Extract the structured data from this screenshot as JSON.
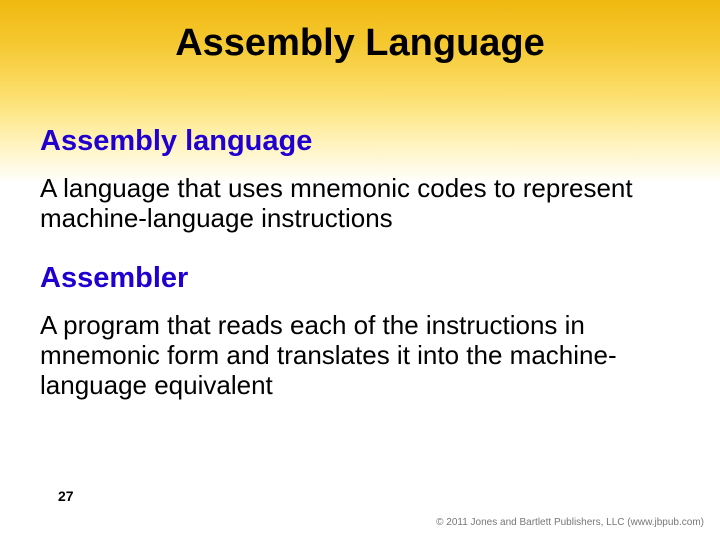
{
  "title": "Assembly Language",
  "sections": [
    {
      "term": "Assembly language",
      "definition": "A language that uses mnemonic codes to represent machine-language instructions"
    },
    {
      "term": "Assembler",
      "definition": "A program  that reads each of the instructions in mnemonic form and translates it into the machine-language equivalent"
    }
  ],
  "page_number": "27",
  "copyright": "© 2011 Jones and Bartlett Publishers, LLC (www.jbpub.com)"
}
